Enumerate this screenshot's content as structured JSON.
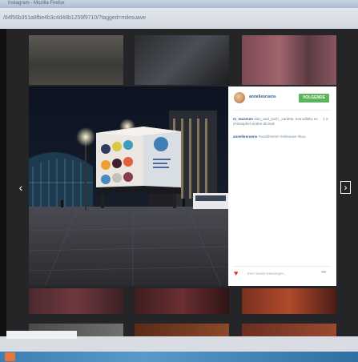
{
  "window": {
    "title": "Instagram - Mozilla Firefox"
  },
  "browser": {
    "address": "/84f56b351a8fbe4b3c4d48b1259f9710/?tagged=milesuave"
  },
  "post": {
    "username": "anneliesruens",
    "follow_label": "VOLGENDE",
    "likes_prefix": "m_museum",
    "likes_text": "stan_and_such _cariette, eva.willekx en christophel vinden dit leuk",
    "age": "3 w",
    "caption_user": "anneliesruens",
    "caption_text": "#ooohhmmm #mileuave #kuu",
    "comment_placeholder": "Een reactie toevoegen...",
    "more_label": "•••"
  },
  "nav": {
    "prev": "‹",
    "next": "›"
  },
  "icons": {
    "heart": "heart-icon",
    "more": "ellipsis-icon",
    "prev": "chevron-left-icon",
    "next": "chevron-right-icon"
  },
  "colors": {
    "follow": "#5cb55c",
    "heart": "#dd3333",
    "link": "#2f5e8c"
  }
}
